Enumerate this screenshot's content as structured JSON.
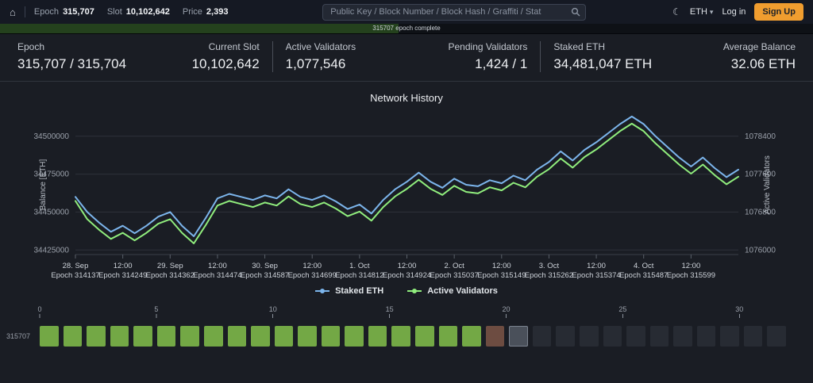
{
  "icons": {
    "home": "⌂",
    "moon": "☾",
    "caret": "▾"
  },
  "navbar": {
    "epoch_label": "Epoch",
    "epoch_value": "315,707",
    "slot_label": "Slot",
    "slot_value": "10,102,642",
    "price_label": "Price",
    "price_value": "2,393",
    "search_placeholder": "Public Key / Block Number / Block Hash / Graffiti / Stat",
    "currency": "ETH",
    "login_label": "Log in",
    "signup_label": "Sign Up"
  },
  "progress": {
    "text": "315707 epoch complete",
    "percent": 49
  },
  "stats": [
    {
      "label": "Epoch",
      "value": "315,707 / 315,704"
    },
    {
      "label": "Current Slot",
      "value": "10,102,642"
    },
    {
      "label": "Active Validators",
      "value": "1,077,546"
    },
    {
      "label": "Pending Validators",
      "value": "1,424 / 1"
    },
    {
      "label": "Staked ETH",
      "value": "34,481,047 ETH"
    },
    {
      "label": "Average Balance",
      "value": "32.06 ETH"
    }
  ],
  "chart_data": {
    "type": "line",
    "title": "Network History",
    "grid": true,
    "legend_position": "bottom",
    "y_left": {
      "label": "Balance [ETH]",
      "ticks": [
        34425000,
        34450000,
        34475000,
        34500000
      ],
      "range": [
        34422000,
        34514000
      ]
    },
    "y_right": {
      "label": "Active Validators",
      "ticks": [
        1076000,
        1076800,
        1077600,
        1078400
      ],
      "range": [
        1075904,
        1078848
      ]
    },
    "x_ticks": [
      {
        "index": 0,
        "date": "28. Sep",
        "epoch": "Epoch 314137"
      },
      {
        "index": 4,
        "date": "12:00",
        "epoch": "Epoch 314249"
      },
      {
        "index": 8,
        "date": "29. Sep",
        "epoch": "Epoch 314362"
      },
      {
        "index": 12,
        "date": "12:00",
        "epoch": "Epoch 314474"
      },
      {
        "index": 16,
        "date": "30. Sep",
        "epoch": "Epoch 314587"
      },
      {
        "index": 20,
        "date": "12:00",
        "epoch": "Epoch 314699"
      },
      {
        "index": 24,
        "date": "1. Oct",
        "epoch": "Epoch 314812"
      },
      {
        "index": 28,
        "date": "12:00",
        "epoch": "Epoch 314924"
      },
      {
        "index": 32,
        "date": "2. Oct",
        "epoch": "Epoch 315037"
      },
      {
        "index": 36,
        "date": "12:00",
        "epoch": "Epoch 315149"
      },
      {
        "index": 40,
        "date": "3. Oct",
        "epoch": "Epoch 315262"
      },
      {
        "index": 44,
        "date": "12:00",
        "epoch": "Epoch 315374"
      },
      {
        "index": 48,
        "date": "4. Oct",
        "epoch": "Epoch 315487"
      },
      {
        "index": 52,
        "date": "12:00",
        "epoch": "Epoch 315599"
      }
    ],
    "series": [
      {
        "name": "Staked ETH",
        "color": "#7cb5ec",
        "axis": "left",
        "values": [
          34460000,
          34450000,
          34443000,
          34437000,
          34441000,
          34436000,
          34441000,
          34447000,
          34450000,
          34441000,
          34434000,
          34446000,
          34459000,
          34462000,
          34460000,
          34458000,
          34461000,
          34459000,
          34465000,
          34460000,
          34458000,
          34461000,
          34457000,
          34452000,
          34455000,
          34449000,
          34458000,
          34465000,
          34470000,
          34476000,
          34470000,
          34466000,
          34472000,
          34468000,
          34467000,
          34471000,
          34469000,
          34474000,
          34471000,
          34478000,
          34483000,
          34490000,
          34484000,
          34491000,
          34496000,
          34502000,
          34508000,
          34513000,
          34508000,
          34500000,
          34493000,
          34486000,
          34480000,
          34486000,
          34479000,
          34473000,
          34478000
        ]
      },
      {
        "name": "Active Validators",
        "color": "#90ed7d",
        "axis": "right",
        "values": [
          1077034,
          1076650,
          1076426,
          1076234,
          1076362,
          1076202,
          1076362,
          1076554,
          1076650,
          1076362,
          1076138,
          1076522,
          1076938,
          1077034,
          1076970,
          1076906,
          1077002,
          1076938,
          1077130,
          1076970,
          1076906,
          1077002,
          1076874,
          1076714,
          1076810,
          1076618,
          1076906,
          1077130,
          1077290,
          1077482,
          1077290,
          1077162,
          1077354,
          1077226,
          1077194,
          1077322,
          1077258,
          1077418,
          1077322,
          1077546,
          1077706,
          1077930,
          1077738,
          1077962,
          1078122,
          1078314,
          1078506,
          1078666,
          1078506,
          1078250,
          1078026,
          1077802,
          1077610,
          1077802,
          1077578,
          1077386,
          1077546
        ]
      }
    ]
  },
  "epoch_strip": {
    "row_label": "315707",
    "slot_count": 32,
    "ruler_ticks": [
      0,
      5,
      10,
      15,
      20,
      25,
      30
    ],
    "status_colors": {
      "proposed": "#73a845",
      "missed": "#6d4c41",
      "current": "#4a505a",
      "scheduled": "#272b33"
    },
    "statuses": [
      "proposed",
      "proposed",
      "proposed",
      "proposed",
      "proposed",
      "proposed",
      "proposed",
      "proposed",
      "proposed",
      "proposed",
      "proposed",
      "proposed",
      "proposed",
      "proposed",
      "proposed",
      "proposed",
      "proposed",
      "proposed",
      "proposed",
      "missed",
      "current",
      "scheduled",
      "scheduled",
      "scheduled",
      "scheduled",
      "scheduled",
      "scheduled",
      "scheduled",
      "scheduled",
      "scheduled",
      "scheduled",
      "scheduled"
    ]
  }
}
